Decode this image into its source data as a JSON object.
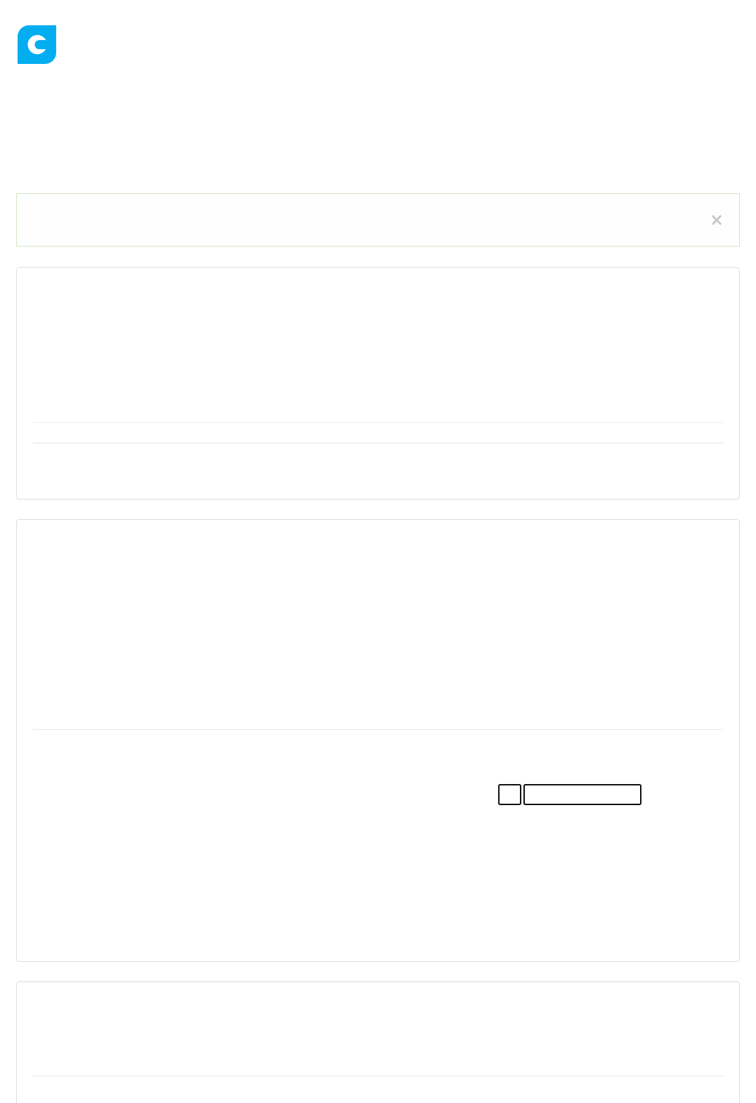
{
  "alert": {
    "close": "×"
  },
  "cards": [
    {
      "kind": "summary"
    },
    {
      "kind": "form"
    },
    {
      "kind": "list"
    }
  ]
}
